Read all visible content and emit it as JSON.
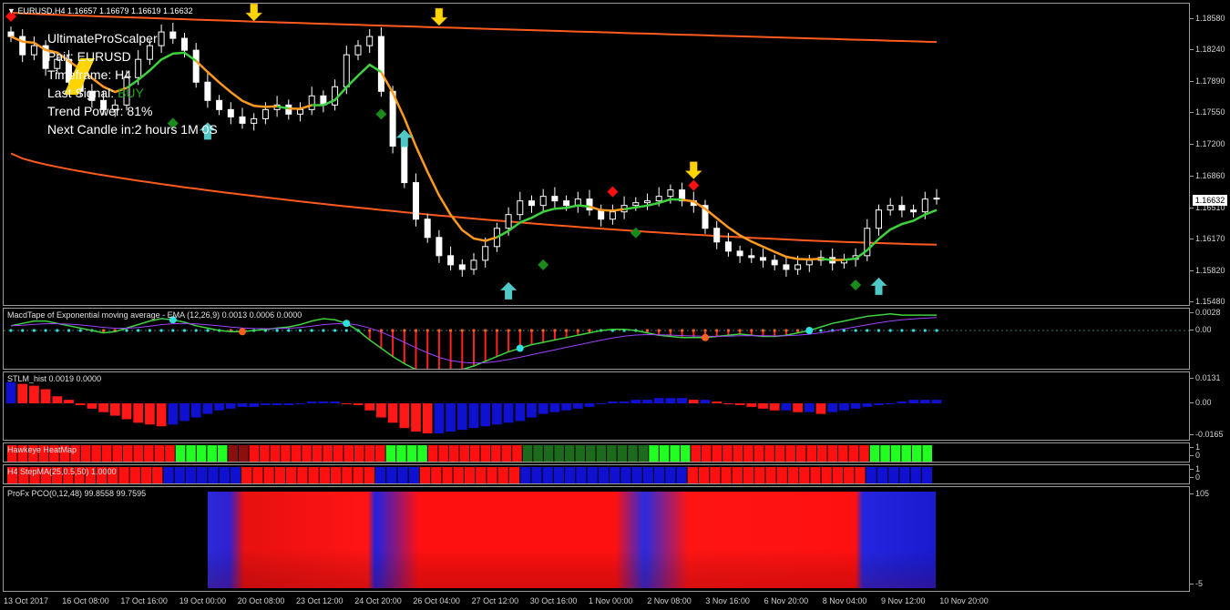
{
  "chart_title": "EURUSD,H4  1.16657 1.16679 1.16619 1.16632",
  "info": {
    "name": "UltimateProScalper",
    "pair": "Pair: EURUSD",
    "timeframe": "Timeframe: H4",
    "last_signal_label": "Last Signal:",
    "last_signal_value": "BUY",
    "trend_power": "Trend Power: 81%",
    "next_candle": "Next Candle in:2 hours 1M 0S"
  },
  "current_price": "1.16632",
  "panels": {
    "macd": "MacdTape of Exponential moving average - EMA (12,26,9) 0.0013 0.0006 0.0000",
    "stlm": "STLM_hist 0.0019 0.0000",
    "heatmap": "Hawkeye HeatMap",
    "stepma": "H4 StepMA(25,0.5,50) 1.0000",
    "pco": "ProFx PCO(0,12,48) 99.8558 99.7595"
  },
  "axes": {
    "price_ticks": [
      "1.18580",
      "1.18240",
      "1.17890",
      "1.17550",
      "1.17200",
      "1.16860",
      "1.16510",
      "1.16170",
      "1.15820",
      "1.15480"
    ],
    "macd_ticks": [
      "0.0028",
      "0.00"
    ],
    "stlm_ticks": [
      "0.0131",
      "0.00",
      "-0.0165"
    ],
    "heatmap_ticks": [
      "1",
      "0"
    ],
    "stepma_ticks": [
      "1",
      "0"
    ],
    "pco_ticks": [
      "105",
      "-5"
    ],
    "time_ticks": [
      "13 Oct 2017",
      "16 Oct 08:00",
      "17 Oct 16:00",
      "19 Oct 00:00",
      "20 Oct 08:00",
      "23 Oct 12:00",
      "24 Oct 20:00",
      "26 Oct 04:00",
      "27 Oct 12:00",
      "30 Oct 16:00",
      "1 Nov 00:00",
      "2 Nov 08:00",
      "3 Nov 16:00",
      "6 Nov 20:00",
      "8 Nov 04:00",
      "9 Nov 12:00",
      "10 Nov 20:00"
    ]
  },
  "chart_data": {
    "type": "line",
    "symbol": "EURUSD",
    "timeframe": "H4",
    "ylim": [
      1.1548,
      1.1872
    ],
    "close": [
      1.184,
      1.182,
      1.183,
      1.1805,
      1.1815,
      1.179,
      1.178,
      1.177,
      1.176,
      1.1765,
      1.1795,
      1.1815,
      1.183,
      1.1845,
      1.1838,
      1.1825,
      1.179,
      1.177,
      1.176,
      1.1752,
      1.1745,
      1.175,
      1.176,
      1.1765,
      1.1755,
      1.176,
      1.1775,
      1.1765,
      1.1785,
      1.182,
      1.183,
      1.184,
      1.178,
      1.172,
      1.168,
      1.164,
      1.162,
      1.16,
      1.159,
      1.1585,
      1.1595,
      1.161,
      1.163,
      1.1645,
      1.166,
      1.1655,
      1.1665,
      1.166,
      1.1655,
      1.1662,
      1.165,
      1.164,
      1.1648,
      1.1655,
      1.1658,
      1.166,
      1.1665,
      1.1672,
      1.166,
      1.1655,
      1.163,
      1.1615,
      1.1605,
      1.16,
      1.1598,
      1.1595,
      1.159,
      1.1585,
      1.159,
      1.1595,
      1.1598,
      1.1592,
      1.1596,
      1.16,
      1.163,
      1.165,
      1.1655,
      1.165,
      1.1648,
      1.1662,
      1.1663
    ],
    "series": [
      {
        "name": "upper_band",
        "color": "#ff5a1e"
      },
      {
        "name": "lower_band",
        "color": "#ff5a1e"
      },
      {
        "name": "signal_line_orange",
        "color": "#ff9a1e"
      },
      {
        "name": "signal_line_green",
        "color": "#3ed23e"
      }
    ],
    "heatmap_segments": [
      {
        "color": "#ff1010",
        "len": 16
      },
      {
        "color": "#22ff22",
        "len": 5
      },
      {
        "color": "#8a1010",
        "len": 2
      },
      {
        "color": "#ff1010",
        "len": 13
      },
      {
        "color": "#22ff22",
        "len": 4
      },
      {
        "color": "#ff1010",
        "len": 9
      },
      {
        "color": "#1c6b1c",
        "len": 12
      },
      {
        "color": "#22ff22",
        "len": 4
      },
      {
        "color": "#ff1010",
        "len": 17
      },
      {
        "color": "#22ff22",
        "len": 6
      }
    ],
    "stepma_segments": [
      {
        "color": "#ff1010",
        "len": 14
      },
      {
        "color": "#1010d0",
        "len": 7
      },
      {
        "color": "#ff1010",
        "len": 12
      },
      {
        "color": "#1010d0",
        "len": 4
      },
      {
        "color": "#ff1010",
        "len": 9
      },
      {
        "color": "#1010d0",
        "len": 15
      },
      {
        "color": "#ff1010",
        "len": 16
      },
      {
        "color": "#1010d0",
        "len": 6
      }
    ],
    "stlm_hist": [
      0.012,
      0.011,
      0.01,
      0.008,
      0.004,
      0.002,
      -0.001,
      -0.003,
      -0.005,
      -0.007,
      -0.009,
      -0.011,
      -0.012,
      -0.013,
      -0.012,
      -0.01,
      -0.008,
      -0.006,
      -0.004,
      -0.003,
      -0.002,
      -0.002,
      -0.001,
      -0.001,
      -0.001,
      0.0,
      0.001,
      0.001,
      0.001,
      0.0,
      -0.001,
      -0.004,
      -0.008,
      -0.011,
      -0.014,
      -0.016,
      -0.017,
      -0.017,
      -0.016,
      -0.015,
      -0.014,
      -0.013,
      -0.012,
      -0.011,
      -0.01,
      -0.008,
      -0.006,
      -0.005,
      -0.004,
      -0.003,
      -0.002,
      0.0,
      0.001,
      0.001,
      0.002,
      0.002,
      0.003,
      0.003,
      0.003,
      0.002,
      0.002,
      0.001,
      0.0,
      -0.001,
      -0.002,
      -0.003,
      -0.004,
      -0.004,
      -0.005,
      -0.005,
      -0.006,
      -0.005,
      -0.004,
      -0.003,
      -0.002,
      -0.001,
      0.0,
      0.001,
      0.002,
      0.002,
      0.002
    ],
    "macd_line": [
      0.0004,
      0.0006,
      0.0008,
      0.0008,
      0.0006,
      0.0004,
      0.0002,
      0.0,
      -0.0002,
      -0.0001,
      0.0002,
      0.0005,
      0.0008,
      0.001,
      0.0009,
      0.0007,
      0.0004,
      0.0002,
      0.0,
      -0.0001,
      -0.0001,
      0.0,
      0.0001,
      0.0002,
      0.0003,
      0.0005,
      0.0008,
      0.001,
      0.0009,
      0.0006,
      0.0,
      -0.0008,
      -0.0015,
      -0.0022,
      -0.0028,
      -0.0033,
      -0.0036,
      -0.0038,
      -0.0036,
      -0.0033,
      -0.003,
      -0.0026,
      -0.0022,
      -0.0018,
      -0.0015,
      -0.0012,
      -0.001,
      -0.0008,
      -0.0006,
      -0.0004,
      -0.0002,
      0.0,
      0.0001,
      0.0001,
      0.0,
      -0.0002,
      -0.0004,
      -0.0005,
      -0.0006,
      -0.0006,
      -0.0006,
      -0.0005,
      -0.0004,
      -0.0003,
      -0.0004,
      -0.0005,
      -0.0005,
      -0.0004,
      -0.0002,
      0.0,
      0.0003,
      0.0006,
      0.0008,
      0.001,
      0.0012,
      0.0013,
      0.0014,
      0.0013,
      0.0013,
      0.0013,
      0.0013
    ]
  }
}
